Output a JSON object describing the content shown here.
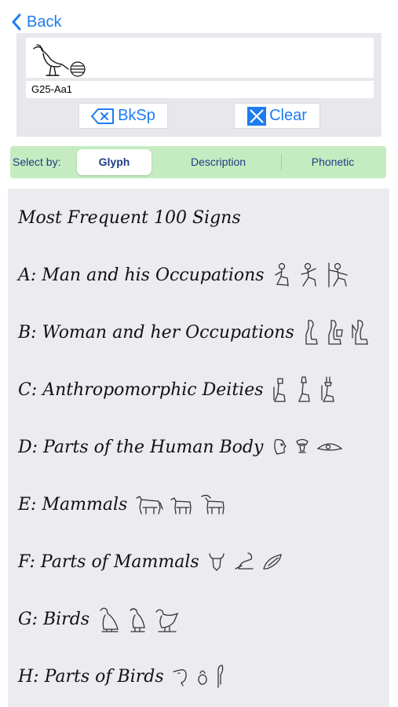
{
  "nav": {
    "back_label": "Back"
  },
  "editor": {
    "code_value": "G25-Aa1",
    "bksp_label": "BkSp",
    "clear_label": "Clear",
    "glyph_icons": [
      "ibis-hieroglyph-icon",
      "placenta-hieroglyph-icon"
    ]
  },
  "selector": {
    "label": "Select by:",
    "options": [
      "Glyph",
      "Description",
      "Phonetic"
    ],
    "selected": "Glyph"
  },
  "categories": [
    {
      "label": "Most Frequent 100 Signs",
      "icons": []
    },
    {
      "label": "A: Man and his Occupations",
      "icons": [
        "seated-man-hieroglyph-icon",
        "kneeling-man-hieroglyph-icon",
        "man-with-staff-hieroglyph-icon"
      ]
    },
    {
      "label": "B: Woman and her Occupations",
      "icons": [
        "seated-woman-hieroglyph-icon",
        "woman-with-child-hieroglyph-icon",
        "woman-holding-hieroglyph-icon"
      ]
    },
    {
      "label": "C: Anthropomorphic Deities",
      "icons": [
        "deity-hieroglyph-icon",
        "deity-crown-hieroglyph-icon",
        "deity-feathers-hieroglyph-icon"
      ]
    },
    {
      "label": "D: Parts of the Human Body",
      "icons": [
        "head-hieroglyph-icon",
        "face-hieroglyph-icon",
        "eye-hieroglyph-icon"
      ]
    },
    {
      "label": "E: Mammals",
      "icons": [
        "bull-hieroglyph-icon",
        "calf-hieroglyph-icon",
        "goat-hieroglyph-icon"
      ]
    },
    {
      "label": "F: Parts of Mammals",
      "icons": [
        "ox-head-hieroglyph-icon",
        "forepart-hieroglyph-icon",
        "tongue-hieroglyph-icon"
      ]
    },
    {
      "label": "G: Birds",
      "icons": [
        "vulture-hieroglyph-icon",
        "falcon-hieroglyph-icon",
        "bird-hieroglyph-icon"
      ]
    },
    {
      "label": "H: Parts of Birds",
      "icons": [
        "bird-head-hieroglyph-icon",
        "egg-hieroglyph-icon",
        "feather-hieroglyph-icon"
      ]
    }
  ],
  "colors": {
    "accent": "#1e7cf2",
    "selector_bg": "#c4ecc0",
    "selector_text": "#1e3d84",
    "panel_bg": "#e7e7ec",
    "list_bg": "#ececf0"
  }
}
